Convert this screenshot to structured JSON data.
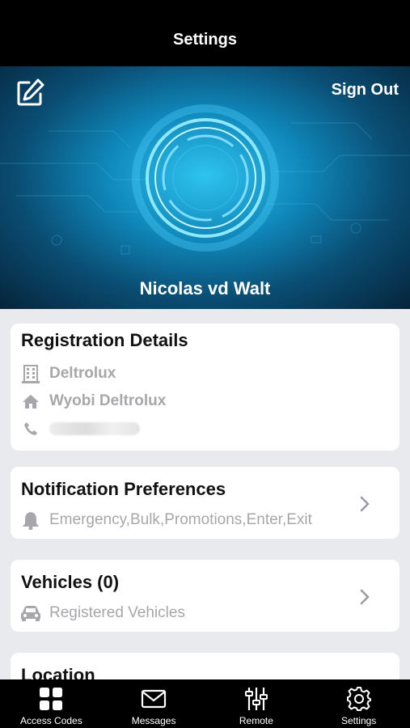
{
  "header": {
    "title": "Settings"
  },
  "profile": {
    "sign_out_label": "Sign Out",
    "user_name": "Nicolas vd Walt"
  },
  "registration": {
    "title": "Registration Details",
    "company": "Deltrolux",
    "estate": "Wyobi Deltrolux",
    "phone": ""
  },
  "notifications": {
    "title": "Notification Preferences",
    "summary": "Emergency,Bulk,Promotions,Enter,Exit"
  },
  "vehicles": {
    "title": "Vehicles (0)",
    "subtitle": "Registered Vehicles"
  },
  "location": {
    "title": "Location"
  },
  "tabbar": {
    "items": [
      {
        "label": "Access Codes",
        "icon": "grid-icon"
      },
      {
        "label": "Messages",
        "icon": "envelope-icon"
      },
      {
        "label": "Remote",
        "icon": "sliders-icon"
      },
      {
        "label": "Settings",
        "icon": "gear-icon"
      }
    ]
  },
  "colors": {
    "accent": "#16a4d8",
    "secondary_text": "#a7a7ab",
    "background": "#e9eaee"
  }
}
